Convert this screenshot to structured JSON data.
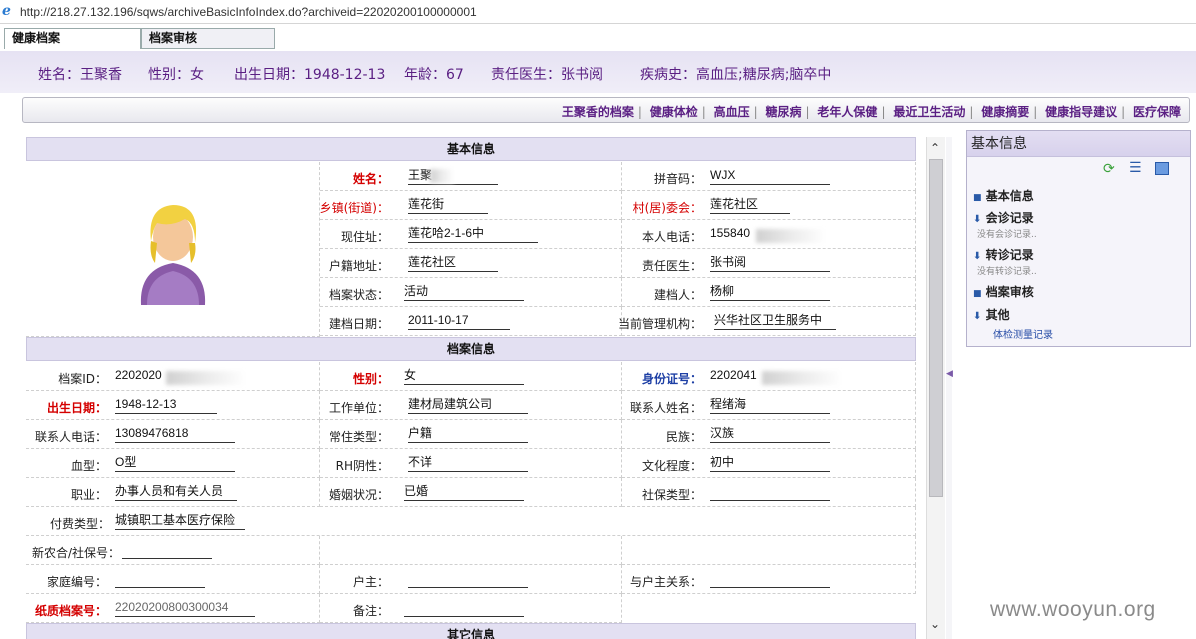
{
  "browser": {
    "url": "http://218.27.132.196/sqws/archiveBasicInfoIndex.do?archiveid=22020200100000001"
  },
  "tabs": [
    "健康档案",
    "档案审核"
  ],
  "header": {
    "name_label": "姓名：",
    "name": "王聚香",
    "gender_label": "性别：",
    "gender": "女",
    "dob_label": "出生日期：",
    "dob": "1948-12-13",
    "age_label": "年龄：",
    "age": "67",
    "doctor_label": "责任医生：",
    "doctor": "张书阅",
    "history_label": "疾病史：",
    "history": "高血压;糖尿病;脑卒中"
  },
  "nav": [
    "王聚香的档案",
    "健康体检",
    "高血压",
    "糖尿病",
    "老年人保健",
    "最近卫生活动",
    "健康摘要",
    "健康指导建议",
    "医疗保障"
  ],
  "nav_sep": "|",
  "sections": {
    "basic": "基本信息",
    "archive": "档案信息",
    "other": "其它信息"
  },
  "basic": {
    "name_l": "姓名：",
    "name_v": "王聚",
    "pinyin_l": "拼音码：",
    "pinyin_v": "WJX",
    "town_l": "乡镇(街道)：",
    "town_v": "莲花街",
    "village_l": "村(居)委会：",
    "village_v": "莲花社区",
    "addr_l": "现住址：",
    "addr_v": "莲花哈2-1-6中",
    "phone_l": "本人电话：",
    "phone_v": "155840",
    "hukou_l": "户籍地址：",
    "hukou_v": "莲花社区",
    "doctor_l": "责任医生：",
    "doctor_v": "张书阅",
    "status_l": "档案状态：",
    "status_v": "活动",
    "creator_l": "建档人：",
    "creator_v": "杨柳",
    "date_l": "建档日期：",
    "date_v": "2011-10-17",
    "org_l": "当前管理机构：",
    "org_v": "兴华社区卫生服务中"
  },
  "archive": {
    "id_l": "档案ID：",
    "id_v": "2202020",
    "gender_l": "性别：",
    "gender_v": "女",
    "idcard_l": "身份证号：",
    "idcard_v": "2202041",
    "dob_l": "出生日期：",
    "dob_v": "1948-12-13",
    "work_l": "工作单位：",
    "work_v": "建材局建筑公司",
    "contact_l": "联系人姓名：",
    "contact_v": "程绪海",
    "cphone_l": "联系人电话：",
    "cphone_v": "13089476818",
    "residence_l": "常住类型：",
    "residence_v": "户籍",
    "ethnic_l": "民族：",
    "ethnic_v": "汉族",
    "blood_l": "血型：",
    "blood_v": "O型",
    "rh_l": "RH阴性：",
    "rh_v": "不详",
    "edu_l": "文化程度：",
    "edu_v": "初中",
    "job_l": "职业：",
    "job_v": "办事人员和有关人员",
    "marriage_l": "婚姻状况：",
    "marriage_v": "已婚",
    "social_l": "社保类型：",
    "social_v": "",
    "pay_l": "付费类型：",
    "pay_v": "城镇职工基本医疗保险",
    "nccms_l": "新农合/社保号：",
    "nccms_v": "",
    "family_l": "家庭编号：",
    "family_v": "",
    "head_l": "户主：",
    "head_v": "",
    "relation_l": "与户主关系：",
    "relation_v": "",
    "paper_l": "纸质档案号：",
    "paper_v": "22020200800300034",
    "note_l": "备注：",
    "note_v": ""
  },
  "side": {
    "title": "基本信息",
    "items": [
      "基本信息",
      "会诊记录",
      "没有会诊记录..",
      "转诊记录",
      "没有转诊记录..",
      "档案审核",
      "其他",
      "体检测量记录"
    ]
  },
  "watermark": "www.wooyun.org"
}
